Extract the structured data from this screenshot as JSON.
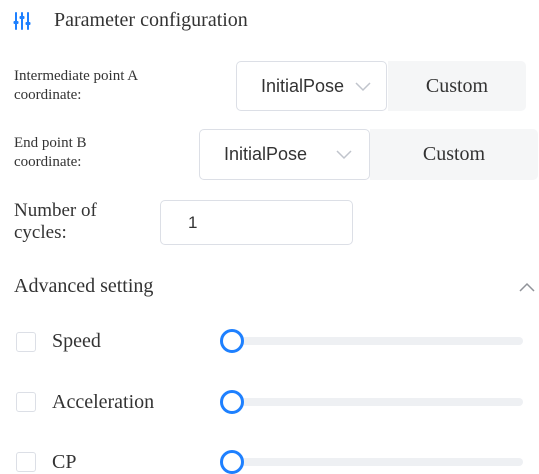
{
  "header": {
    "title": "Parameter configuration",
    "icon": "sliders-icon",
    "accent_color": "#1e80ff"
  },
  "params": {
    "point_a": {
      "label_line1": "Intermediate point A",
      "label_line2": "coordinate:",
      "select_value": "InitialPose",
      "custom_label": "Custom"
    },
    "point_b": {
      "label_line1": "End point B",
      "label_line2": "coordinate:",
      "select_value": "InitialPose",
      "custom_label": "Custom"
    },
    "cycles": {
      "label_line1": "Number of",
      "label_line2": "cycles:",
      "value": "1"
    }
  },
  "advanced": {
    "title": "Advanced setting",
    "expanded": true,
    "items": [
      {
        "label": "Speed",
        "checked": false,
        "slider_value": 0
      },
      {
        "label": "Acceleration",
        "checked": false,
        "slider_value": 0
      },
      {
        "label": "CP",
        "checked": false,
        "slider_value": 0
      }
    ]
  }
}
